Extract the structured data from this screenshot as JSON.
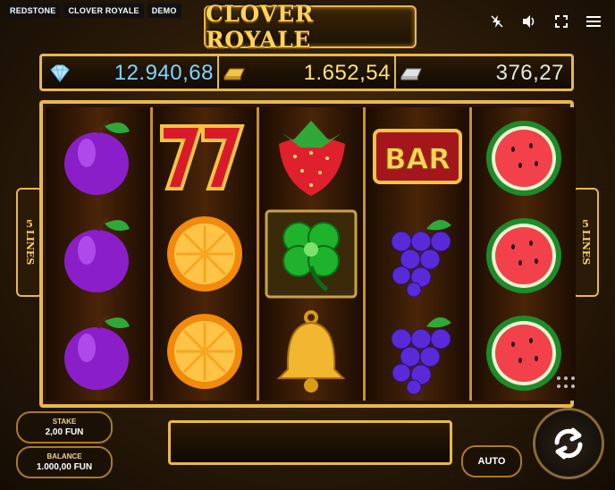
{
  "tags": [
    "REDSTONE",
    "CLOVER ROYALE",
    "DEMO"
  ],
  "logo": "CLOVER ROYALE",
  "top_icons": [
    "turbo-off-icon",
    "sound-icon",
    "fullscreen-icon",
    "menu-icon"
  ],
  "jackpots": [
    {
      "icon": "diamond-icon",
      "value": "12.940,68"
    },
    {
      "icon": "gold-bar-icon",
      "value": "1.652,54"
    },
    {
      "icon": "silver-bar-icon",
      "value": "376,27"
    }
  ],
  "lines_label": {
    "number": "5",
    "word": "LINES"
  },
  "reels": [
    [
      "plum",
      "plum",
      "plum"
    ],
    [
      "seven",
      "orange",
      "orange"
    ],
    [
      "strawberry",
      "clover",
      "bell"
    ],
    [
      "bar",
      "grapes",
      "grapes"
    ],
    [
      "watermelon",
      "watermelon",
      "watermelon"
    ]
  ],
  "bar_text": "BAR",
  "stake": {
    "label": "STAKE",
    "value": "2,00 FUN"
  },
  "balance": {
    "label": "BALANCE",
    "value": "1.000,00 FUN"
  },
  "auto_label": "AUTO",
  "colors": {
    "gold": "#e7b94b",
    "diamond": "#7fd4ff",
    "gold_value": "#ffe27a"
  }
}
